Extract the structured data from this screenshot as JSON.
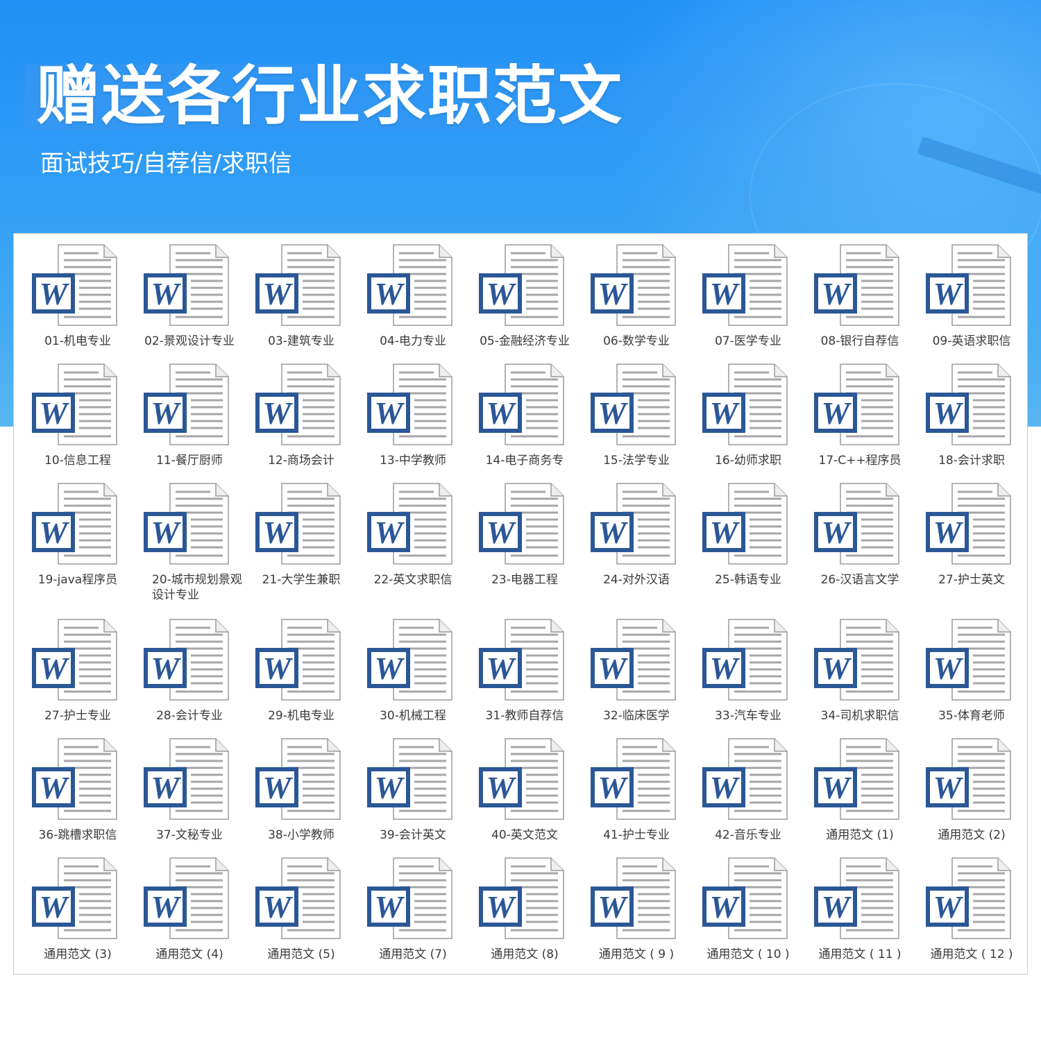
{
  "banner": {
    "title": "赠送各行业求职范文",
    "subtitle": "面试技巧/自荐信/求职信"
  },
  "colors": {
    "banner_top": "#1f8ff5",
    "banner_bottom": "#58b6f1",
    "word_blue": "#2b5797",
    "panel_border": "#c9c9c9"
  },
  "icon": {
    "name": "word-document-icon",
    "letter": "W"
  },
  "files": [
    "01-机电专业",
    "02-景观设计专业",
    "03-建筑专业",
    "04-电力专业",
    "05-金融经济专业",
    "06-数学专业",
    "07-医学专业",
    "08-银行自荐信",
    "09-英语求职信",
    "10-信息工程",
    "11-餐厅厨师",
    "12-商场会计",
    "13-中学教师",
    "14-电子商务专",
    "15-法学专业",
    "16-幼师求职",
    "17-C++程序员",
    "18-会计求职",
    "19-java程序员",
    "20-城市规划景观设计专业",
    "21-大学生兼职",
    "22-英文求职信",
    "23-电器工程",
    "24-对外汉语",
    "25-韩语专业",
    "26-汉语言文学",
    "27-护士英文",
    "27-护士专业",
    "28-会计专业",
    "29-机电专业",
    "30-机械工程",
    "31-教师自荐信",
    "32-临床医学",
    "33-汽车专业",
    "34-司机求职信",
    "35-体育老师",
    "36-跳槽求职信",
    "37-文秘专业",
    "38-小学教师",
    "39-会计英文",
    "40-英文范文",
    "41-护士专业",
    "42-音乐专业",
    "通用范文 (1)",
    "通用范文 (2)",
    "通用范文 (3)",
    "通用范文 (4)",
    "通用范文 (5)",
    "通用范文 (7)",
    "通用范文 (8)",
    "通用范文 ( 9 )",
    "通用范文 ( 10 )",
    "通用范文 ( 11 )",
    "通用范文 ( 12 )"
  ]
}
